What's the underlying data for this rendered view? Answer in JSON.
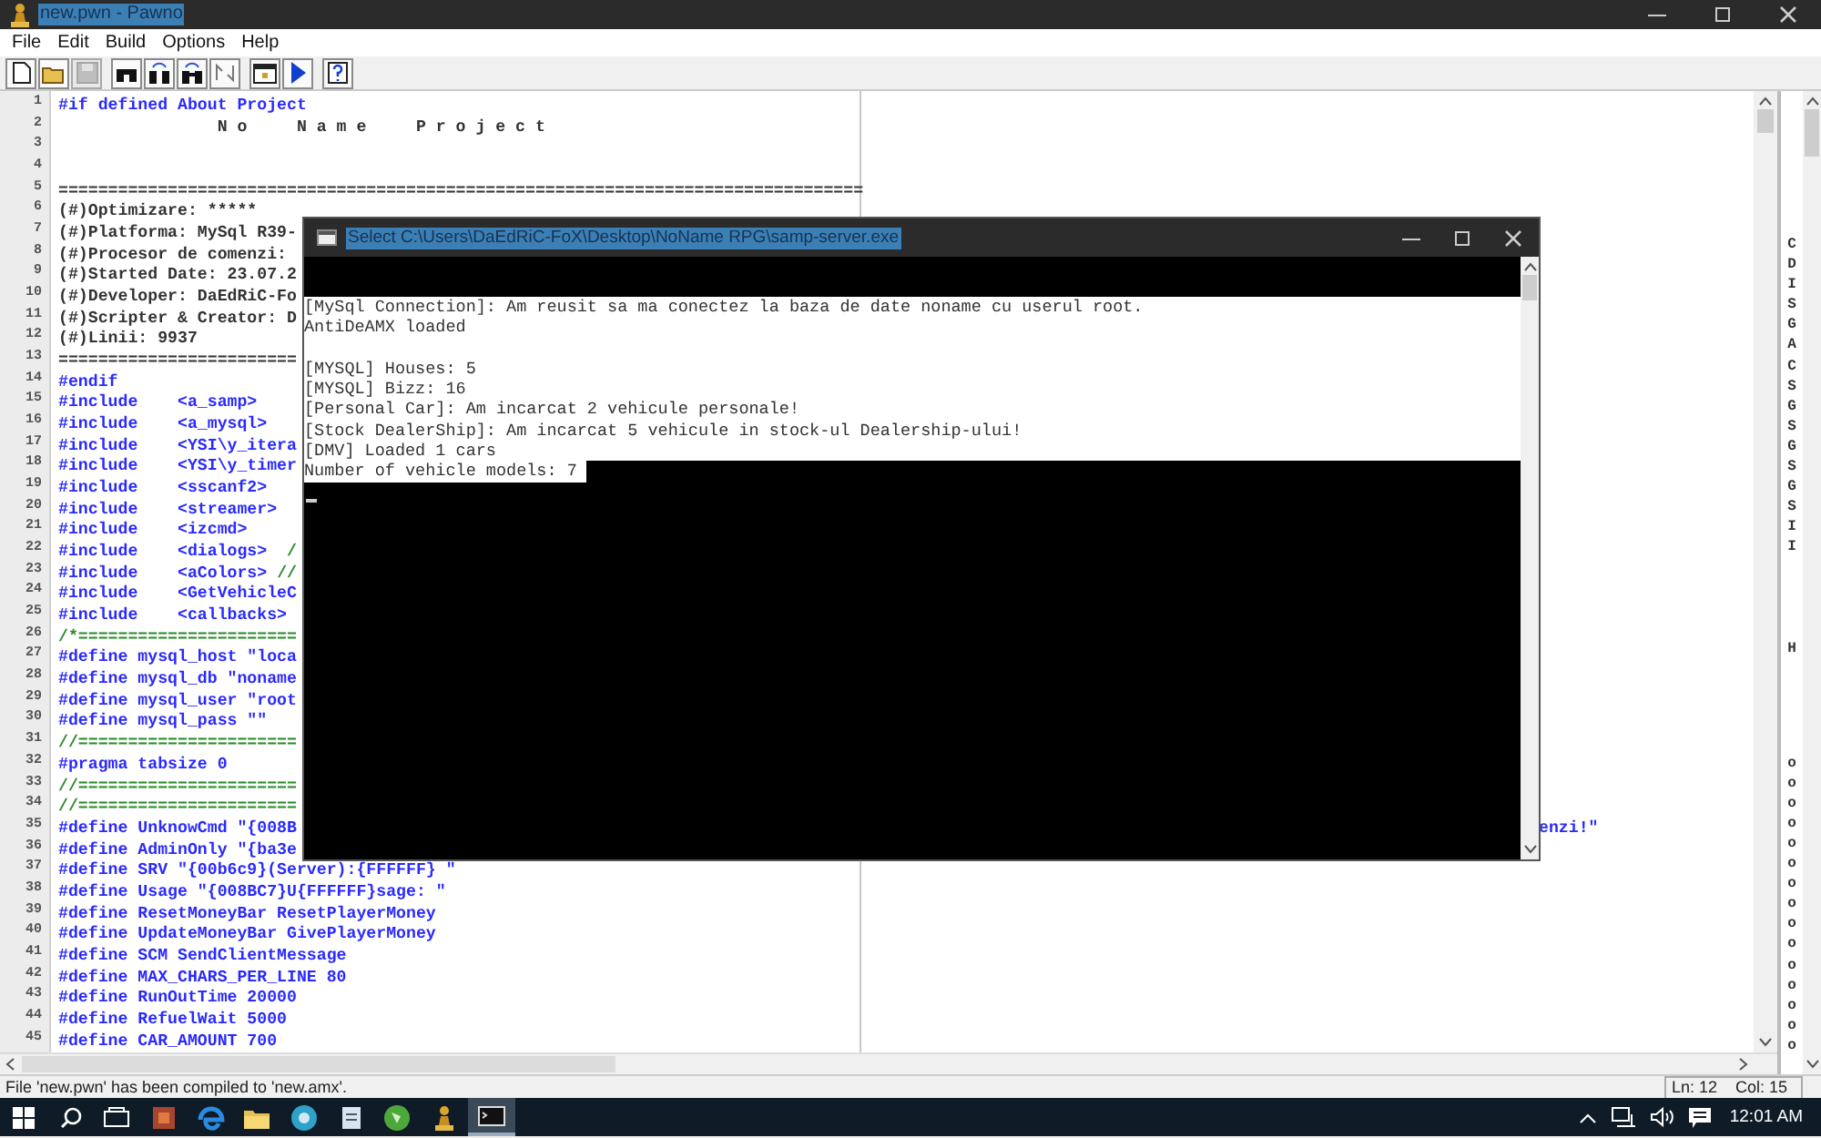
{
  "window": {
    "title": "new.pwn - Pawno"
  },
  "menu": [
    "File",
    "Edit",
    "Build",
    "Options",
    "Help"
  ],
  "toolbar": [
    {
      "kind": "new",
      "disabled": false
    },
    {
      "kind": "open",
      "disabled": false
    },
    {
      "kind": "save",
      "disabled": true
    },
    {
      "kind": "find",
      "disabled": false
    },
    {
      "kind": "find-next",
      "disabled": false
    },
    {
      "kind": "replace",
      "disabled": false
    },
    {
      "kind": "goto",
      "disabled": false
    },
    {
      "kind": "compile",
      "disabled": false
    },
    {
      "kind": "run",
      "disabled": false
    },
    {
      "kind": "help",
      "disabled": false
    }
  ],
  "editor": {
    "lines": [
      {
        "number": "1",
        "kind": "code",
        "text": "#if defined About Project"
      },
      {
        "number": "2",
        "kind": "plain",
        "text": "                N o     N a m e     P r o j e c t"
      },
      {
        "number": "3"
      },
      {
        "number": "4"
      },
      {
        "number": "5",
        "kind": "plain",
        "text": "================================================================================="
      },
      {
        "number": "6",
        "kind": "plain",
        "text": "(#)Optimizare: *****"
      },
      {
        "number": "7",
        "kind": "plain",
        "text": "(#)Platforma: MySql R39-"
      },
      {
        "number": "8",
        "kind": "plain",
        "text": "(#)Procesor de comenzi:"
      },
      {
        "number": "9",
        "kind": "plain",
        "text": "(#)Started Date: 23.07.2"
      },
      {
        "number": "10",
        "kind": "plain",
        "text": "(#)Developer: DaEdRiC-Fo"
      },
      {
        "number": "11",
        "kind": "plain",
        "text": "(#)Scripter & Creator: D"
      },
      {
        "number": "12",
        "kind": "plain",
        "text": "(#)Linii: 9937"
      },
      {
        "number": "13",
        "kind": "plain",
        "text": "========================"
      },
      {
        "number": "14",
        "kind": "code",
        "text": "#endif"
      },
      {
        "number": "15",
        "kind": "code",
        "text": "#include    <a_samp>"
      },
      {
        "number": "16",
        "kind": "code",
        "text": "#include    <a_mysql>"
      },
      {
        "number": "17",
        "kind": "code",
        "text": "#include    <YSI\\y_itera"
      },
      {
        "number": "18",
        "kind": "code",
        "text": "#include    <YSI\\y_timer"
      },
      {
        "number": "19",
        "kind": "code",
        "text": "#include    <sscanf2>"
      },
      {
        "number": "20",
        "kind": "code",
        "text": "#include    <streamer>"
      },
      {
        "number": "21",
        "kind": "code",
        "text": "#include    <izcmd>"
      },
      {
        "number": "22",
        "kind": "code",
        "text": "#include    <dialogs>",
        "comment": "  /"
      },
      {
        "number": "23",
        "kind": "code",
        "text": "#include    <aColors>",
        "comment": " //"
      },
      {
        "number": "24",
        "kind": "code",
        "text": "#include    <GetVehicleC"
      },
      {
        "number": "25",
        "kind": "code",
        "text": "#include    <callbacks>"
      },
      {
        "number": "26",
        "kind": "comment",
        "text": "/*======================"
      },
      {
        "number": "27",
        "kind": "code",
        "text": "#define mysql_host \"loca"
      },
      {
        "number": "28",
        "kind": "code",
        "text": "#define mysql_db \"noname"
      },
      {
        "number": "29",
        "kind": "code",
        "text": "#define mysql_user \"root"
      },
      {
        "number": "30",
        "kind": "code",
        "text": "#define mysql_pass \"\""
      },
      {
        "number": "31",
        "kind": "comment",
        "text": "//======================"
      },
      {
        "number": "32",
        "kind": "code",
        "text": "#pragma tabsize 0"
      },
      {
        "number": "33",
        "kind": "comment",
        "text": "//======================"
      },
      {
        "number": "34",
        "kind": "comment",
        "text": "//======================"
      },
      {
        "number": "35",
        "kind": "code",
        "text": "#define UnknowCmd \"{008B",
        "tail": "enzi!\""
      },
      {
        "number": "36",
        "kind": "code",
        "text": "#define AdminOnly \"{ba3e"
      },
      {
        "number": "37",
        "kind": "code",
        "text": "#define SRV \"{00b6c9}(Server):{FFFFFF} \""
      },
      {
        "number": "38",
        "kind": "code",
        "text": "#define Usage \"{008BC7}U{FFFFFF}sage: \""
      },
      {
        "number": "39",
        "kind": "code",
        "text": "#define ResetMoneyBar ResetPlayerMoney"
      },
      {
        "number": "40",
        "kind": "code",
        "text": "#define UpdateMoneyBar GivePlayerMoney"
      },
      {
        "number": "41",
        "kind": "code",
        "text": "#define SCM SendClientMessage"
      },
      {
        "number": "42",
        "kind": "code",
        "text": "#define MAX_CHARS_PER_LINE 80"
      },
      {
        "number": "43",
        "kind": "code",
        "text": "#define RunOutTime 20000"
      },
      {
        "number": "44",
        "kind": "code",
        "text": "#define RefuelWait 5000"
      },
      {
        "number": "45",
        "kind": "code",
        "text": "#define CAR_AMOUNT 700"
      }
    ]
  },
  "outline": {
    "groups": [
      {
        "items": [
          "C",
          "D",
          "I",
          "S",
          "G",
          "A",
          "C",
          "S",
          "G",
          "S",
          "G",
          "S",
          "G",
          "S",
          "I",
          "I"
        ]
      },
      {
        "items": [
          "H"
        ]
      },
      {
        "items": [
          "o",
          "o",
          "o",
          "o",
          "o",
          "o",
          "o",
          "o",
          "o",
          "o",
          "o",
          "o",
          "o",
          "o",
          "o"
        ]
      }
    ]
  },
  "console": {
    "title": "Select C:\\Users\\DaEdRiC-FoX\\Desktop\\NoName RPG\\samp-server.exe",
    "lines": [
      {
        "kind": "text",
        "text": "[MySql Connection]: Am reusit sa ma conectez la baza de date noname cu userul root."
      },
      {
        "kind": "text",
        "text": "AntiDeAMX loaded"
      },
      {
        "kind": "blank"
      },
      {
        "kind": "text",
        "text": "[MYSQL] Houses: 5"
      },
      {
        "kind": "text",
        "text": "[MYSQL] Bizz: 16"
      },
      {
        "kind": "text",
        "text": "[Personal Car]: Am incarcat 2 vehicule personale!"
      },
      {
        "kind": "text",
        "text": "[Stock DealerShip]: Am incarcat 5 vehicule in stock-ul Dealership-ului!"
      },
      {
        "kind": "text",
        "text": "[DMV] Loaded 1 cars"
      },
      {
        "kind": "text",
        "text": "Number of vehicle models: 7 "
      }
    ]
  },
  "status_bar": {
    "message": "File 'new.pwn' has been compiled to 'new.amx'.",
    "line": "Ln: 12",
    "column": "Col: 15"
  },
  "taskbar": {
    "apps": [
      {
        "kind": "media",
        "active": false
      },
      {
        "kind": "edge",
        "active": false
      },
      {
        "kind": "explorer",
        "active": false
      },
      {
        "kind": "browser",
        "active": false
      },
      {
        "kind": "notes",
        "active": false
      },
      {
        "kind": "globe",
        "active": false
      },
      {
        "kind": "pawno",
        "active": false
      },
      {
        "kind": "console",
        "active": true
      }
    ],
    "clock": "12:01 AM"
  }
}
